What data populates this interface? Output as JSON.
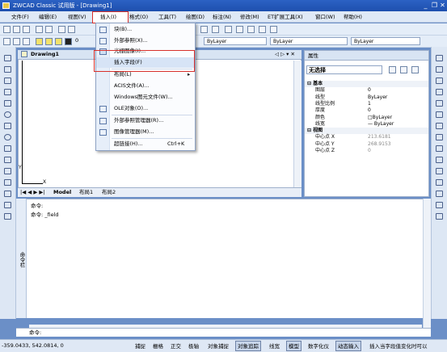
{
  "window": {
    "title": "ZWCAD Classic 试用版 - [Drawing1]",
    "buttons": [
      "_",
      "❐",
      "✕"
    ]
  },
  "menubar": {
    "items": [
      "文件(F)",
      "编辑(E)",
      "视图(V)",
      "插入(I)",
      "格式(O)",
      "工具(T)",
      "绘图(D)",
      "标注(N)",
      "修改(M)",
      "ET扩展工具(X)",
      "窗口(W)",
      "帮助(H)"
    ],
    "active": "插入(I)"
  },
  "toolbar": {
    "layer_combo": "ByLayer",
    "linetype_combo": "ByLayer",
    "lineweight_combo": "ByLayer",
    "layer_zero": "0"
  },
  "drawing": {
    "tab_title": "Drawing1",
    "tab_controls": "◁ ▷ ▾ ✕",
    "ucs_x": "X",
    "ucs_y": "Y"
  },
  "layout_tabs": {
    "nav": "|◀ ◀ ▶ ▶|",
    "tabs": [
      "Model",
      "布局1",
      "布局2"
    ]
  },
  "properties": {
    "title": "属性",
    "selection": "无选择",
    "sections": [
      {
        "name": "基本",
        "rows": [
          {
            "key": "图层",
            "value": "0"
          },
          {
            "key": "线型",
            "value": "ByLayer"
          },
          {
            "key": "线型比例",
            "value": "1"
          },
          {
            "key": "厚度",
            "value": "0"
          },
          {
            "key": "颜色",
            "value": "□ByLayer"
          },
          {
            "key": "线宽",
            "value": "— ByLayer"
          }
        ]
      },
      {
        "name": "视图",
        "rows": [
          {
            "key": "中心点 X",
            "value": "213.6181"
          },
          {
            "key": "中心点 Y",
            "value": "268.9153"
          },
          {
            "key": "中心点 Z",
            "value": "0"
          }
        ]
      }
    ]
  },
  "insert_menu": {
    "items": [
      {
        "label": "块(B)...",
        "shortcut": "",
        "icon": "block-icon"
      },
      {
        "label": "外部参照(X)...",
        "shortcut": "",
        "icon": "xref-icon"
      },
      {
        "label": "光栅图像(I)...",
        "shortcut": "",
        "icon": "image-icon"
      },
      {
        "label": "插入字段(F)",
        "shortcut": "",
        "icon": "",
        "highlighted": true
      },
      {
        "label": "布局(L)",
        "shortcut": "▸",
        "icon": ""
      },
      {
        "label": "ACIS文件(A)...",
        "shortcut": "",
        "icon": ""
      },
      {
        "label": "Windows图元文件(W)...",
        "shortcut": "",
        "icon": ""
      },
      {
        "label": "OLE对象(O)...",
        "shortcut": "",
        "icon": "ole-icon"
      },
      {
        "label": "外部参照管理器(R)...",
        "shortcut": "",
        "icon": "xref-manager-icon"
      },
      {
        "label": "图像管理器(M)...",
        "shortcut": "",
        "icon": "image-manager-icon"
      },
      {
        "label": "超链接(H)...",
        "shortcut": "Ctrl+K",
        "icon": ""
      }
    ]
  },
  "command": {
    "panel_title": "命令栏",
    "history": [
      "命令:",
      "命令: _field"
    ],
    "prompt": "命令:"
  },
  "statusbar": {
    "coords": "-359.0433, 542.0814, 0",
    "buttons": [
      {
        "label": "捕捉",
        "on": false
      },
      {
        "label": "栅格",
        "on": false
      },
      {
        "label": "正交",
        "on": false
      },
      {
        "label": "极轴",
        "on": false
      },
      {
        "label": "对象捕捉",
        "on": false
      },
      {
        "label": "对象追踪",
        "on": true
      },
      {
        "label": "线宽",
        "on": false
      },
      {
        "label": "模型",
        "on": true
      },
      {
        "label": "数字化仪",
        "on": false
      },
      {
        "label": "动态输入",
        "on": true
      },
      {
        "label": "插入当字段值变化时可以",
        "on": false
      }
    ]
  },
  "colors": {
    "accent": "#1d4fae",
    "highlight": "#d8302b",
    "workspace": "#6b8fc7"
  }
}
